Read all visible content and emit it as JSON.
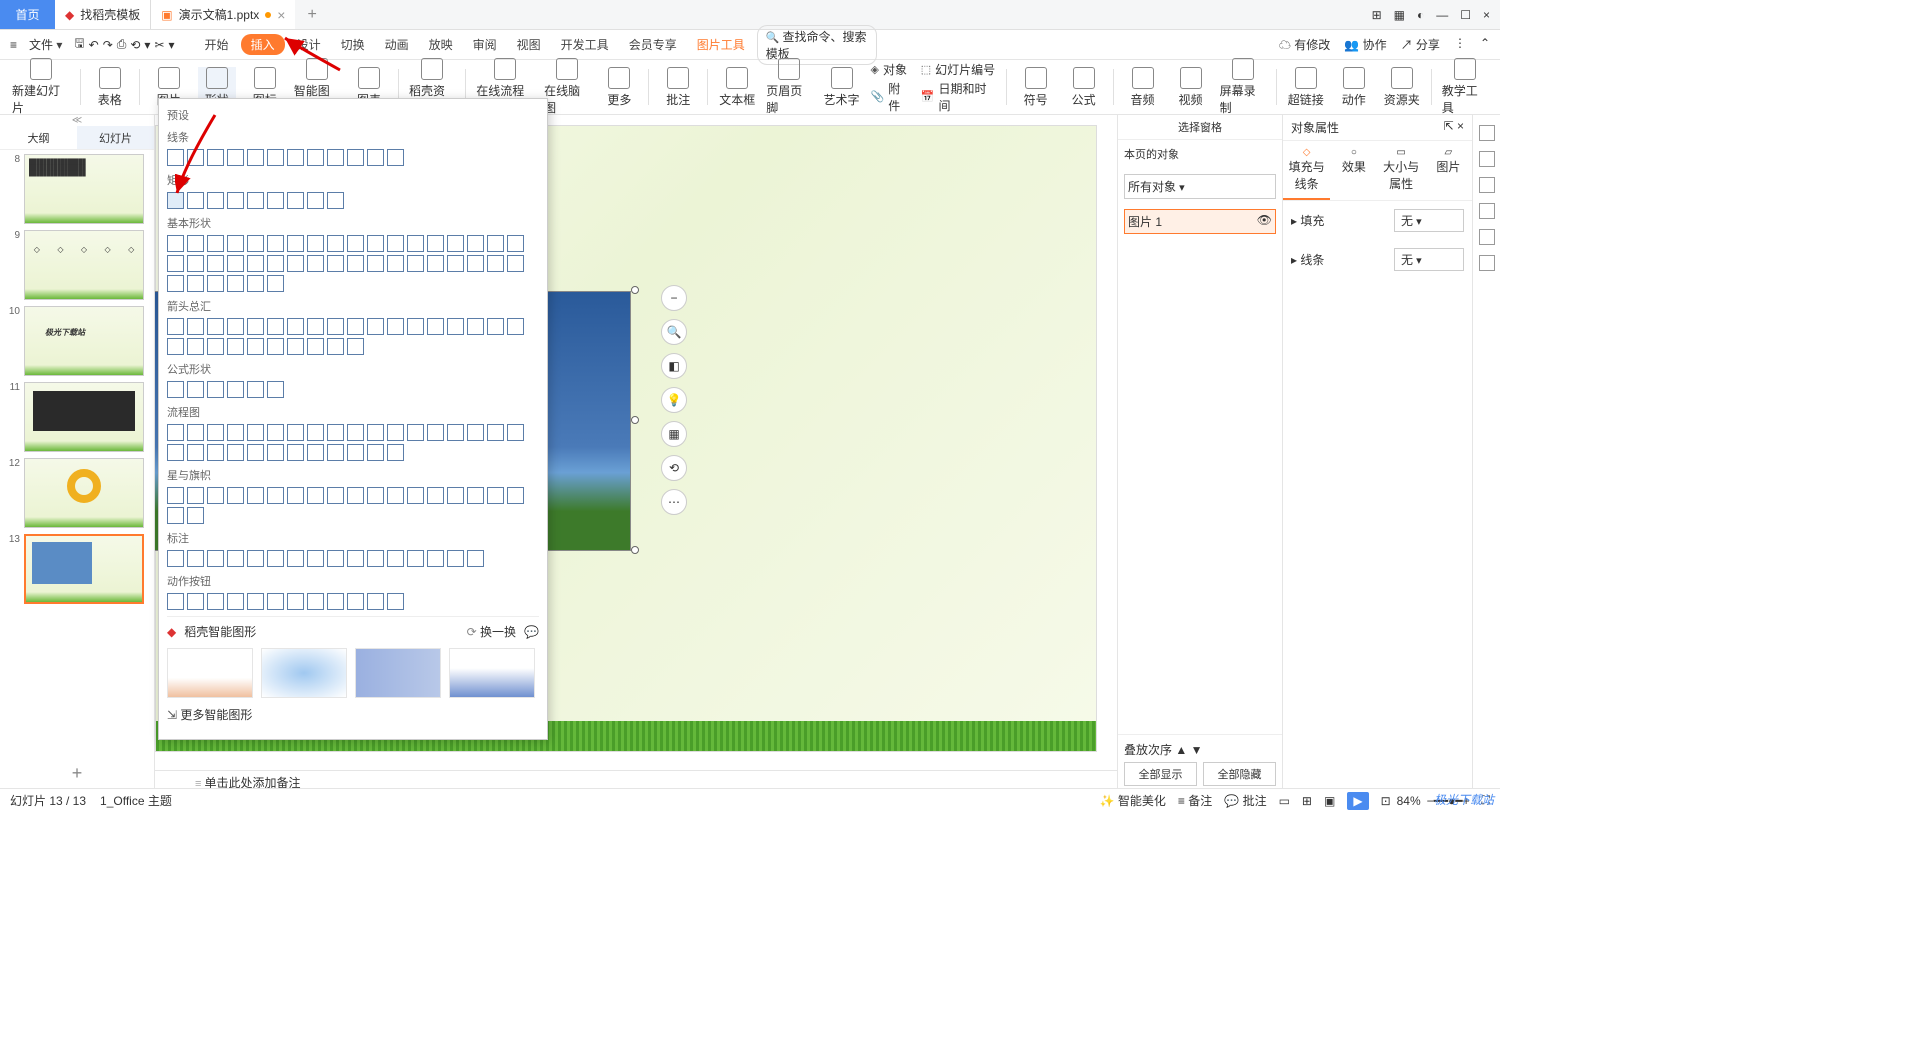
{
  "tabs": {
    "home": "首页",
    "template": "找稻壳模板",
    "doc": "演示文稿1.pptx"
  },
  "menu": {
    "file": "文件",
    "start": "开始",
    "insert": "插入",
    "design": "设计",
    "trans": "切换",
    "anim": "动画",
    "play": "放映",
    "review": "审阅",
    "view": "视图",
    "dev": "开发工具",
    "member": "会员专享",
    "pictool": "图片工具",
    "search": "查找命令、搜索模板",
    "repair": "有修改",
    "collab": "协作",
    "share": "分享"
  },
  "ribbon": {
    "newslide": "新建幻灯片",
    "table": "表格",
    "picture": "图片",
    "shape": "形状",
    "icon": "图标",
    "smartart": "智能图形",
    "chart": "图表",
    "res": "稻壳资源",
    "flow": "在线流程图",
    "mind": "在线脑图",
    "more": "更多",
    "comment": "批注",
    "textbox": "文本框",
    "headfoot": "页眉页脚",
    "wordart": "艺术字",
    "object": "对象",
    "slidenum": "幻灯片编号",
    "attach": "附件",
    "datetime": "日期和时间",
    "symbol": "符号",
    "formula": "公式",
    "audio": "音频",
    "video": "视频",
    "screenrec": "屏幕录制",
    "hyperlink": "超链接",
    "action": "动作",
    "respack": "资源夹",
    "teach": "教学工具"
  },
  "side": {
    "outline": "大纲",
    "slides": "幻灯片"
  },
  "thumbs": [
    {
      "n": "8"
    },
    {
      "n": "9"
    },
    {
      "n": "10"
    },
    {
      "n": "11"
    },
    {
      "n": "12"
    },
    {
      "n": "13"
    }
  ],
  "notes": "单击此处添加备注",
  "dropdown": {
    "preset": "预设",
    "lines": "线条",
    "rect": "矩形",
    "basic": "基本形状",
    "arrows": "箭头总汇",
    "formula": "公式形状",
    "flow": "流程图",
    "stars": "星与旗帜",
    "callout": "标注",
    "action": "动作按钮",
    "smart": "稻壳智能图形",
    "change": "换一换",
    "more": "更多智能图形"
  },
  "selpane": {
    "title": "选择窗格",
    "home": "本页的对象",
    "all": "所有对象",
    "item": "图片 1",
    "stack": "叠放次序",
    "showall": "全部显示",
    "hideall": "全部隐藏"
  },
  "attrpane": {
    "title": "对象属性",
    "fillline": "填充与线条",
    "effect": "效果",
    "sizeprop": "大小与属性",
    "pic": "图片",
    "fill": "填充",
    "line": "线条",
    "none": "无"
  },
  "status": {
    "pos": "幻灯片 13 / 13",
    "theme": "1_Office 主题",
    "beautify": "智能美化",
    "oplog": "备注",
    "comment": "批注",
    "zoom": "84%"
  },
  "watermark": "极光下载站"
}
